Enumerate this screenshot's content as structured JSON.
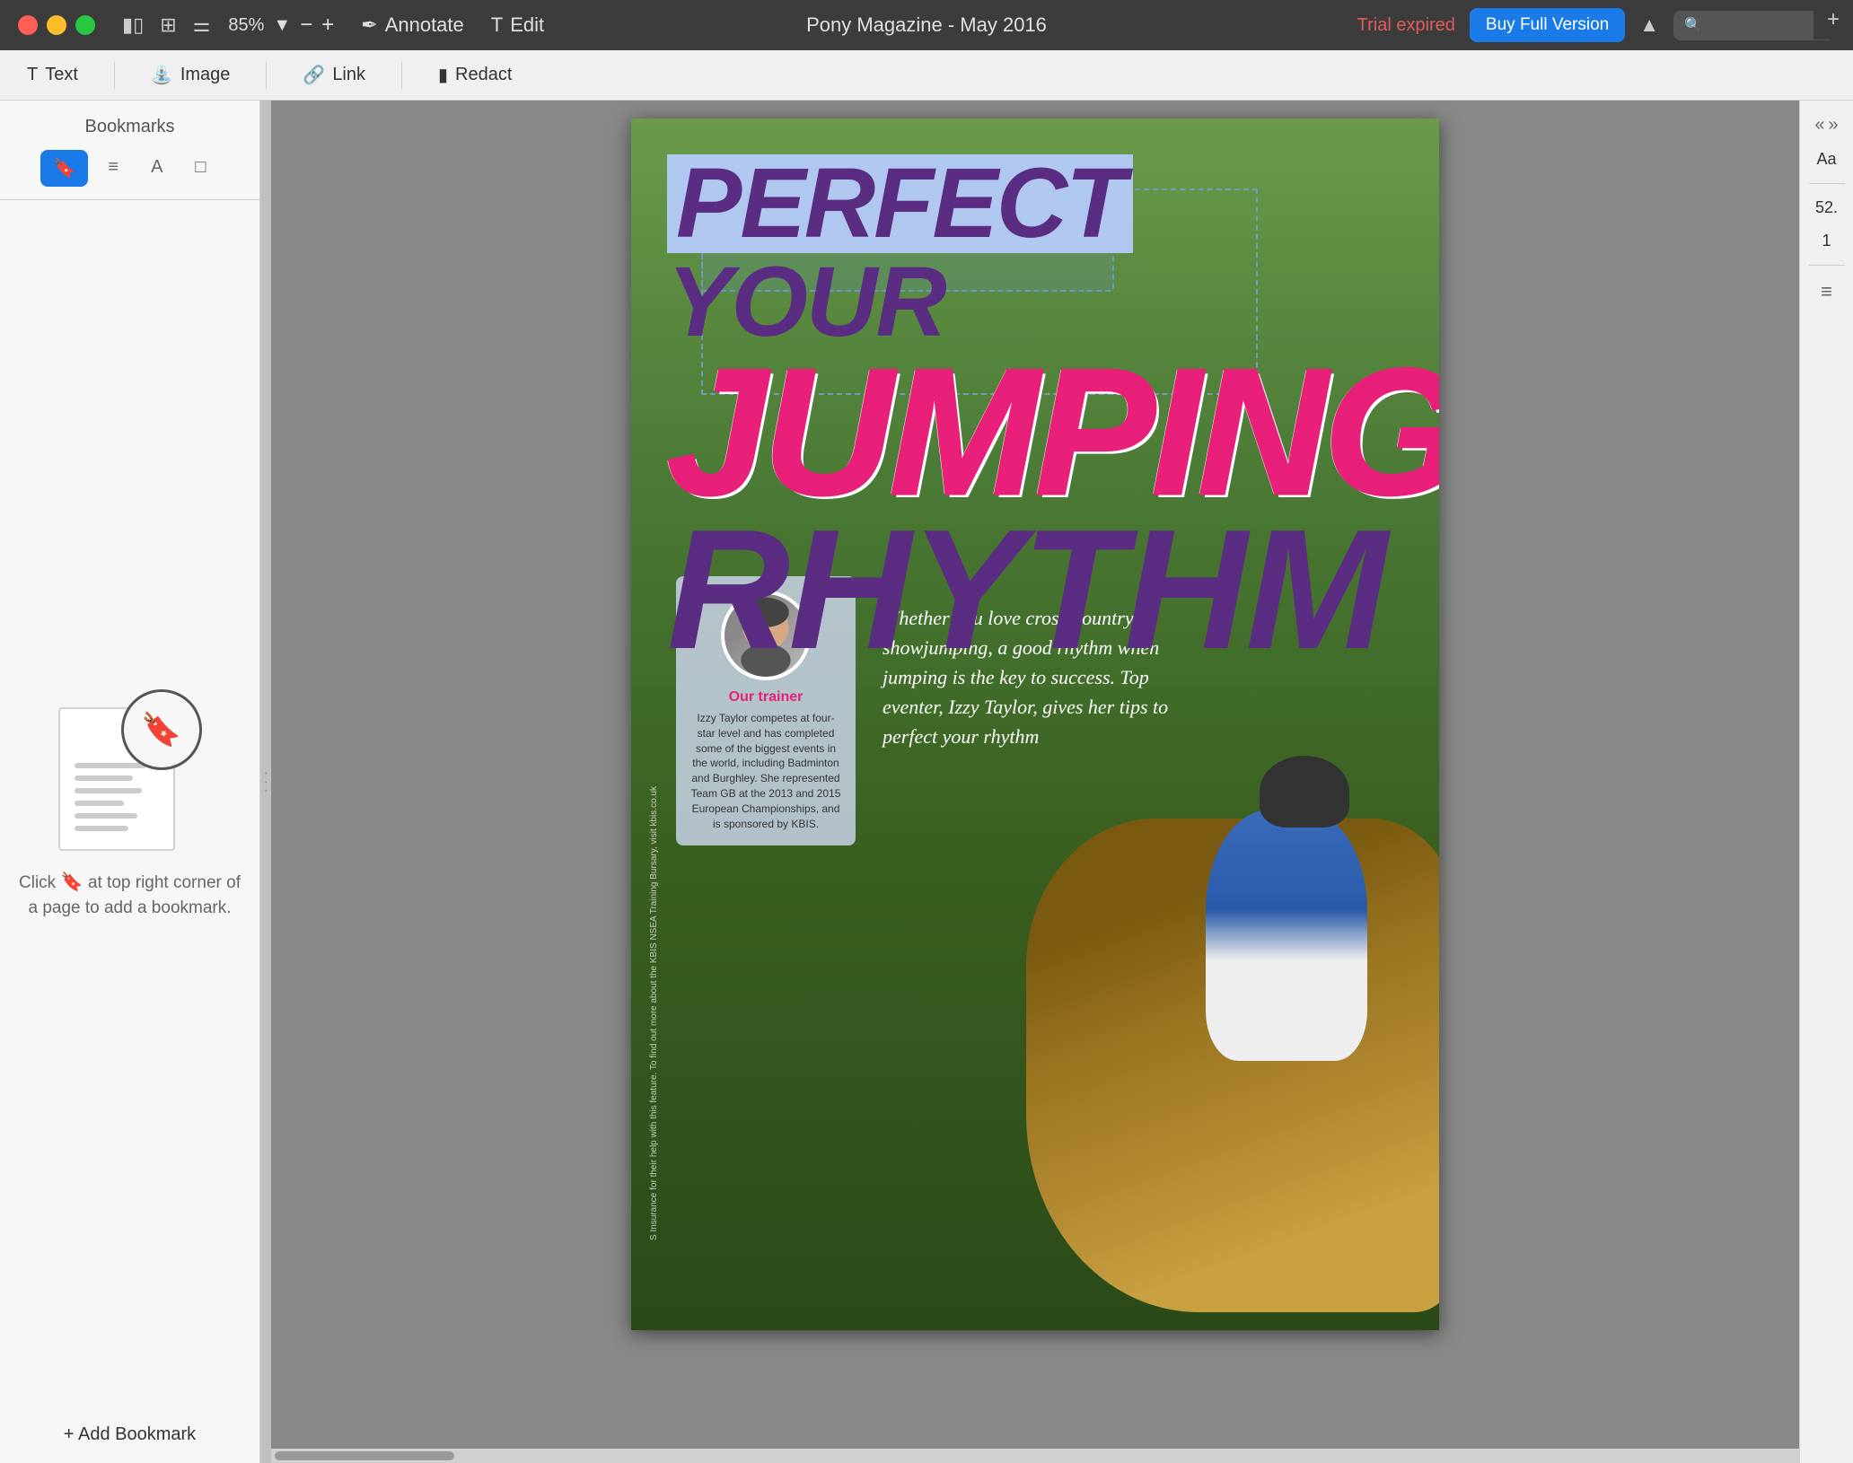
{
  "window": {
    "title": "Pony Magazine - May 2016",
    "zoom": "85%",
    "tab_title": "Pony Magazine - May 2016"
  },
  "titlebar": {
    "traffic_lights": [
      "red",
      "yellow",
      "green"
    ],
    "annotate_label": "Annotate",
    "edit_label": "Edit",
    "trial_text": "Trial expired",
    "buy_label": "Buy Full Version",
    "zoom_value": "85%",
    "zoom_minus": "−",
    "zoom_plus": "+",
    "plus_tab": "+"
  },
  "toolbar2": {
    "text_label": "Text",
    "image_label": "Image",
    "link_label": "Link",
    "redact_label": "Redact"
  },
  "sidebar": {
    "title": "Bookmarks",
    "tabs": [
      {
        "label": "🔖",
        "active": true
      },
      {
        "label": "≡"
      },
      {
        "label": "A"
      },
      {
        "label": "□"
      }
    ],
    "hint_pre": "Click",
    "hint_icon": "🔖",
    "hint_post": "at top right corner of a page to add a bookmark.",
    "add_bookmark_label": "+ Add Bookmark"
  },
  "right_panel": {
    "aa_label": "Aa",
    "page_num": "52.",
    "page_sub": "1",
    "collapse_left": "«",
    "collapse_right": "»",
    "lines_icon": "≡"
  },
  "page": {
    "perfect": "PERFECT",
    "your": " YOUR",
    "jumping": "JUMPING",
    "rhythm": "RHYTHM",
    "trainer_title": "Our trainer",
    "trainer_desc": "Izzy Taylor competes at four-star level and has completed some of the biggest events in the world, including Badminton and Burghley. She represented Team GB at the 2013 and 2015 European Championships, and is sponsored by KBIS.",
    "intro_text": "Whether you love cross-country or showjumping, a good rhythm when jumping is the key to success. Top eventer, Izzy Taylor, gives her tips to perfect your rhythm",
    "side_text": "S Insurance for their help with this feature. To find out more about the KBIS NSEA Training Bursary, visit kbis.co.uk"
  }
}
